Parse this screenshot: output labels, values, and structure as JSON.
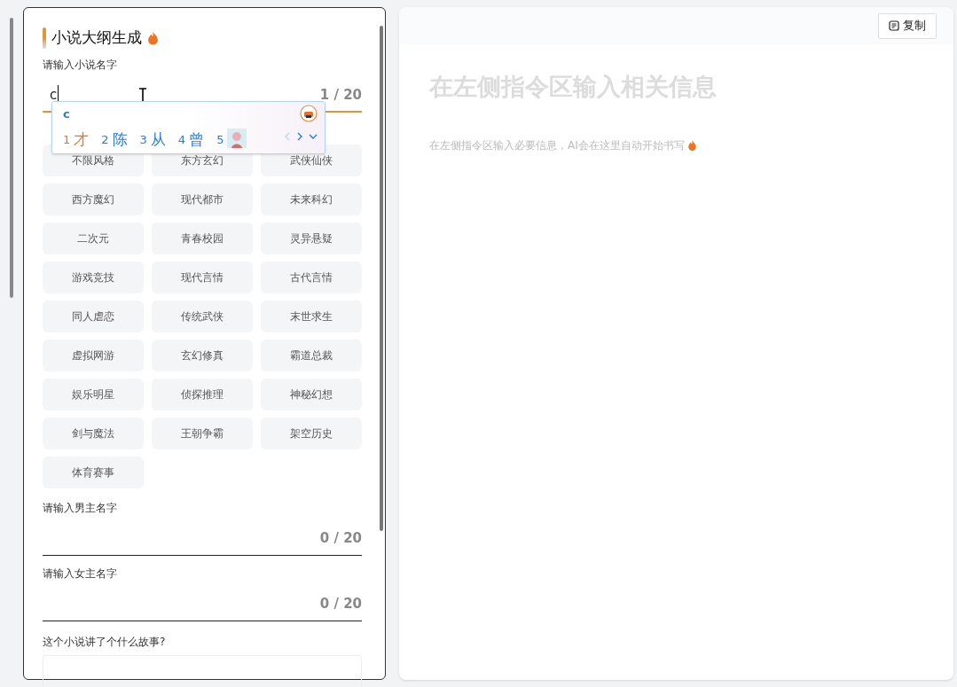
{
  "form": {
    "title": "小说大纲生成",
    "name_field": {
      "label": "请输入小说名字",
      "value": "c",
      "counter": "1 / 20",
      "focused": true
    },
    "ime": {
      "input": "c",
      "candidates": [
        {
          "number": "1",
          "text": "才",
          "selected": true,
          "kind": "text"
        },
        {
          "number": "2",
          "text": "陈",
          "selected": false,
          "kind": "text"
        },
        {
          "number": "3",
          "text": "从",
          "selected": false,
          "kind": "text"
        },
        {
          "number": "4",
          "text": "曾",
          "selected": false,
          "kind": "text"
        },
        {
          "number": "5",
          "selected": false,
          "kind": "picture"
        }
      ]
    },
    "genres": [
      {
        "label": "不限风格"
      },
      {
        "label": "东方玄幻"
      },
      {
        "label": "武侠仙侠"
      },
      {
        "label": "西方魔幻"
      },
      {
        "label": "现代都市"
      },
      {
        "label": "未来科幻"
      },
      {
        "label": "二次元"
      },
      {
        "label": "青春校园"
      },
      {
        "label": "灵异悬疑"
      },
      {
        "label": "游戏竞技"
      },
      {
        "label": "现代言情"
      },
      {
        "label": "古代言情"
      },
      {
        "label": "同人虐恋"
      },
      {
        "label": "传统武侠"
      },
      {
        "label": "末世求生"
      },
      {
        "label": "虚拟网游"
      },
      {
        "label": "玄幻修真"
      },
      {
        "label": "霸道总裁"
      },
      {
        "label": "娱乐明星"
      },
      {
        "label": "侦探推理"
      },
      {
        "label": "神秘幻想"
      },
      {
        "label": "剑与魔法"
      },
      {
        "label": "王朝争霸"
      },
      {
        "label": "架空历史"
      },
      {
        "label": "体育赛事"
      }
    ],
    "male_field": {
      "label": "请输入男主名字",
      "counter": "0 / 20",
      "focused": false
    },
    "female_field": {
      "label": "请输入女主名字",
      "counter": "0 / 20",
      "focused": false
    },
    "story_field": {
      "label": "这个小说讲了个什么故事?"
    }
  },
  "output": {
    "copy_button": "复制",
    "heading": "在左侧指令区输入相关信息",
    "hint": "在左侧指令区输入必要信息，AI会在这里自动开始书写"
  }
}
